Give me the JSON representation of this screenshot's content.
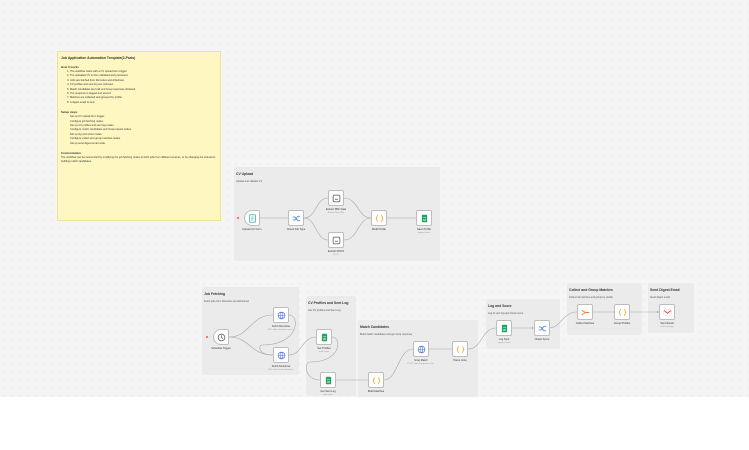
{
  "sticky_note": {
    "title": "Job Application Automation Template(2-Parts)",
    "how_title": "How it works",
    "how_steps": [
      "The workflow starts with a CV upload form trigger.",
      "The uploaded CV is then validated and processed.",
      "Jobs are fetched from Remotive and Arbeitnow.",
      "CV profiles and sent log are retrieved.",
      "Match candidates are built and Groq responses obtained.",
      "The response is logged and scored.",
      "Matches are collected and grouped by profile.",
      "A digest email is sent."
    ],
    "setup_title": "Setup steps",
    "setup_steps": [
      "Set up CV upload form trigger.",
      "Configure job fetching nodes.",
      "Set up CV profiles and sent log nodes.",
      "Configure match candidates and Groq request nodes.",
      "Set up log and score nodes.",
      "Configure collect and group matches nodes.",
      "Set up send digest email node."
    ],
    "custom_title": "Customization",
    "custom_text": "The workflow can be customized by modifying the job fetching nodes to fetch jobs from different sources, or by changing the criteria for building match candidates."
  },
  "groups": {
    "cv_upload": {
      "title": "CV Upload",
      "subtitle": "Upload and validate CV"
    },
    "job_fetching": {
      "title": "Job Fetching",
      "subtitle": "Fetch jobs from Remotive and Arbeitnow"
    },
    "cv_profiles": {
      "title": "CV Profiles and Sent Log",
      "subtitle": "Get CV profiles and Sent Log"
    },
    "match": {
      "title": "Match Candidates",
      "subtitle": "Build match candidates and get Groq response"
    },
    "log_score": {
      "title": "Log and Score",
      "subtitle": "Log to sent log and check score"
    },
    "collect": {
      "title": "Collect and Group Matches",
      "subtitle": "Collect all matches and group by profile"
    },
    "digest": {
      "title": "Send Digest Email",
      "subtitle": "Send digest email"
    }
  },
  "nodes": {
    "upload_cv_form": {
      "label": "Upload CV Form",
      "icon": "form-icon"
    },
    "check_file_type": {
      "label": "Check File Type",
      "icon": "switch-icon"
    },
    "extract_pdf": {
      "label": "Extract PDF Data",
      "sub": "Extract From PDF",
      "icon": "extract-icon"
    },
    "extract_docx": {
      "label": "Extract DOCX",
      "sub": "DOCX",
      "icon": "extract-icon"
    },
    "build_profile": {
      "label": "Build Profile",
      "icon": "code-icon"
    },
    "save_profile": {
      "label": "Save Profile",
      "sub": "append: sheet",
      "icon": "sheets-icon"
    },
    "schedule_trigger": {
      "label": "Schedule Trigger",
      "icon": "clock-icon"
    },
    "fetch_remotive": {
      "label": "Fetch Remotive",
      "sub": "GET: https://remotive.com/a...",
      "icon": "globe-icon"
    },
    "fetch_arbeitnow": {
      "label": "Fetch Arbeitnow",
      "sub": "GET: https://www.arbeitnow...",
      "icon": "globe-icon"
    },
    "get_profiles": {
      "label": "Get Profiles",
      "sub": "read: sheet",
      "icon": "sheets-icon"
    },
    "get_sent_log": {
      "label": "Get Sent Log",
      "sub": "read: sheet",
      "icon": "sheets-icon"
    },
    "build_matches": {
      "label": "Build Matches",
      "sub": "",
      "icon": "code-icon"
    },
    "groq_match": {
      "label": "Groq Match",
      "sub": "POST: https://api.groq.com/o...",
      "icon": "globe-icon"
    },
    "parse_groq": {
      "label": "Parse Groq",
      "icon": "code-icon"
    },
    "log_sent": {
      "label": "Log Sent",
      "sub": "append: sheet",
      "icon": "sheets-icon"
    },
    "check_score": {
      "label": "Check Score",
      "icon": "switch-icon"
    },
    "collect_matches": {
      "label": "Collect Matches",
      "icon": "aggregate-icon"
    },
    "group_profiles": {
      "label": "Group Profiles",
      "icon": "code-icon"
    },
    "send_email": {
      "label": "Send Email",
      "sub": "send: message",
      "icon": "gmail-icon"
    }
  }
}
